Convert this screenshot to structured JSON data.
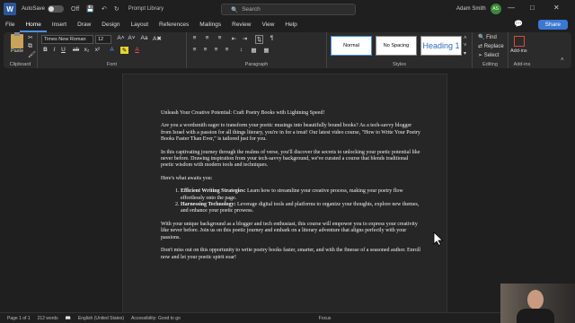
{
  "titlebar": {
    "app_letter": "W",
    "autosave_label": "AutoSave",
    "autosave_state": "Off",
    "doc_name": "Prompt Library",
    "search_placeholder": "Search",
    "user_name": "Adam Smith",
    "user_initials": "AS"
  },
  "menu": {
    "tabs": [
      "File",
      "Home",
      "Insert",
      "Draw",
      "Design",
      "Layout",
      "References",
      "Mailings",
      "Review",
      "View",
      "Help"
    ],
    "active_tab": "Home",
    "share_label": "Share"
  },
  "ribbon": {
    "clipboard": {
      "paste_label": "Paste",
      "group_label": "Clipboard"
    },
    "font": {
      "font_name": "Times New Roman",
      "font_size": "12",
      "group_label": "Font"
    },
    "paragraph": {
      "group_label": "Paragraph"
    },
    "styles": {
      "items": [
        "Normal",
        "No Spacing",
        "Heading 1"
      ],
      "active": "Normal",
      "group_label": "Styles"
    },
    "editing": {
      "find_label": "Find",
      "replace_label": "Replace",
      "select_label": "Select",
      "group_label": "Editing"
    },
    "addins": {
      "label": "Add-ins",
      "group_label": "Add-ins"
    }
  },
  "document": {
    "title": "Unleash Your Creative Potential: Craft Poetry Books with Lightning Speed!",
    "para1": "Are you a wordsmith eager to transform your poetic musings into beautifully bound books? As a tech-savvy blogger from Israel with a passion for all things literary, you're in for a treat! Our latest video course, \"How to Write Your Poetry Books Faster Than Ever,\" is tailored just for you.",
    "para2": "In this captivating journey through the realms of verse, you'll discover the secrets to unlocking your poetic potential like never before. Drawing inspiration from your tech-savvy background, we've curated a course that blends traditional poetic wisdom with modern tools and techniques.",
    "para3": "Here's what awaits you:",
    "list": [
      {
        "bold": "Efficient Writing Strategies:",
        "text": " Learn how to streamline your creative process, making your poetry flow effortlessly onto the page."
      },
      {
        "bold": "Harnessing Technology:",
        "text": " Leverage digital tools and platforms to organize your thoughts, explore new themes, and enhance your poetic prowess."
      }
    ],
    "para4": "With your unique background as a blogger and tech enthusiast, this course will empower you to express your creativity like never before. Join us on this poetic journey and embark on a literary adventure that aligns perfectly with your passions.",
    "para5": "Don't miss out on this opportunity to write poetry books faster, smarter, and with the finesse of a seasoned author. Enroll now and let your poetic spirit soar!"
  },
  "status": {
    "page": "Page 1 of 1",
    "words": "212 words",
    "language": "English (United States)",
    "accessibility": "Accessibility: Good to go",
    "focus": "Focus"
  }
}
